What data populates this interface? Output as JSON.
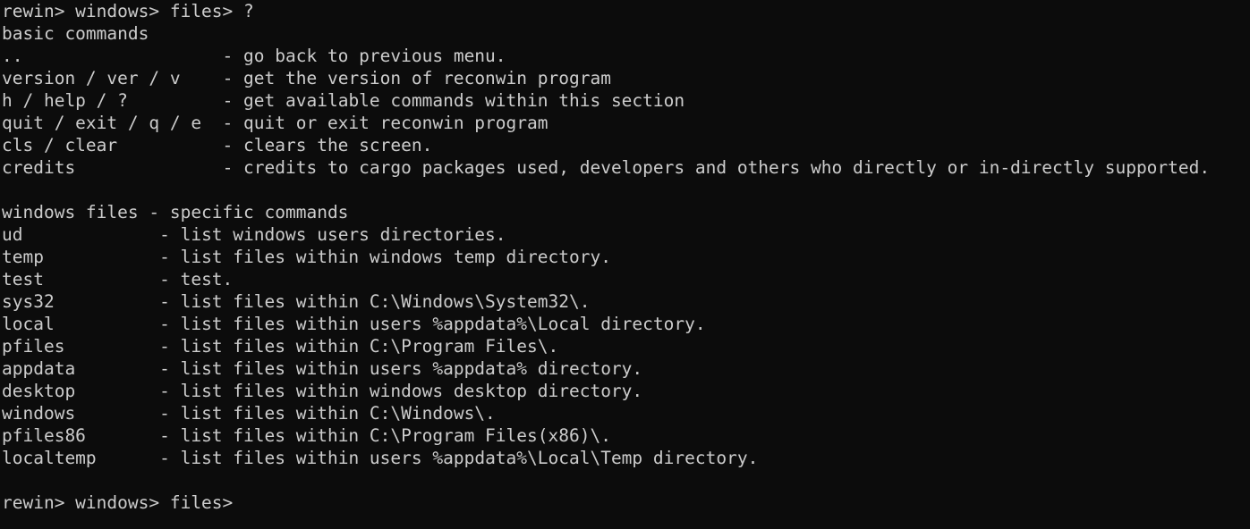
{
  "prompt": "rewin> windows> files> ",
  "first_command": "?",
  "basic": {
    "header": "basic commands",
    "items": [
      {
        "cmd": "..",
        "desc": "- go back to previous menu."
      },
      {
        "cmd": "version / ver / v",
        "desc": "- get the version of reconwin program"
      },
      {
        "cmd": "h / help / ?",
        "desc": "- get available commands within this section"
      },
      {
        "cmd": "quit / exit / q / e",
        "desc": "- quit or exit reconwin program"
      },
      {
        "cmd": "cls / clear",
        "desc": "- clears the screen."
      },
      {
        "cmd": "credits",
        "desc": "- credits to cargo packages used, developers and others who directly or in-directly supported."
      }
    ]
  },
  "specific": {
    "header": "windows files - specific commands",
    "items": [
      {
        "cmd": "ud",
        "desc": "- list windows users directories."
      },
      {
        "cmd": "temp",
        "desc": "- list files within windows temp directory."
      },
      {
        "cmd": "test",
        "desc": "- test."
      },
      {
        "cmd": "sys32",
        "desc": "- list files within C:\\Windows\\System32\\."
      },
      {
        "cmd": "local",
        "desc": "- list files within users %appdata%\\Local directory."
      },
      {
        "cmd": "pfiles",
        "desc": "- list files within C:\\Program Files\\."
      },
      {
        "cmd": "appdata",
        "desc": "- list files within users %appdata% directory."
      },
      {
        "cmd": "desktop",
        "desc": "- list files within windows desktop directory."
      },
      {
        "cmd": "windows",
        "desc": "- list files within C:\\Windows\\."
      },
      {
        "cmd": "pfiles86",
        "desc": "- list files within C:\\Program Files(x86)\\."
      },
      {
        "cmd": "localtemp",
        "desc": "- list files within users %appdata%\\Local\\Temp directory."
      }
    ]
  },
  "colors": {
    "background": "#0c0c0c",
    "foreground": "#cccccc"
  }
}
